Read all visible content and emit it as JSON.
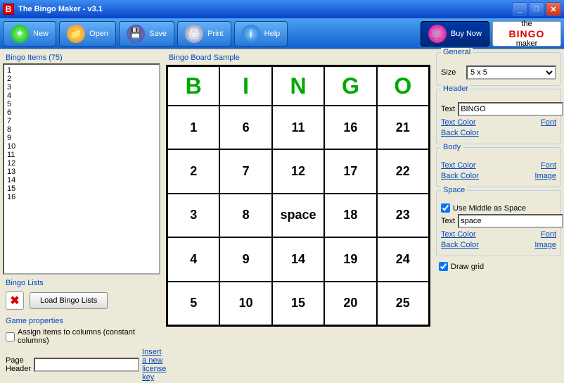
{
  "window": {
    "title": "The Bingo Maker - v3.1"
  },
  "toolbar": {
    "new": "New",
    "open": "Open",
    "save": "Save",
    "print": "Print",
    "help": "Help",
    "buy": "Buy Now"
  },
  "logo": {
    "small": "the",
    "big": "BINGO",
    "sub": "maker"
  },
  "left": {
    "items_label": "Bingo Items (75)",
    "items": [
      "1",
      "2",
      "3",
      "4",
      "5",
      "6",
      "7",
      "8",
      "9",
      "10",
      "11",
      "12",
      "13",
      "14",
      "15",
      "16"
    ],
    "lists_label": "Bingo Lists",
    "load_btn": "Load Bingo Lists",
    "gameprops_label": "Game properties",
    "assign_label": "Assign items to columns (constant columns)",
    "page_header_label": "Page Header",
    "page_header_value": "",
    "insert_license": "Insert a new license key"
  },
  "center": {
    "label": "Bingo Board Sample",
    "headers": [
      "B",
      "I",
      "N",
      "G",
      "O"
    ],
    "cells": [
      [
        "1",
        "6",
        "11",
        "16",
        "21"
      ],
      [
        "2",
        "7",
        "12",
        "17",
        "22"
      ],
      [
        "3",
        "8",
        "space",
        "18",
        "23"
      ],
      [
        "4",
        "9",
        "14",
        "19",
        "24"
      ],
      [
        "5",
        "10",
        "15",
        "20",
        "25"
      ]
    ]
  },
  "right": {
    "general": {
      "label": "General",
      "size_label": "Size",
      "size_value": "5 x 5"
    },
    "header": {
      "label": "Header",
      "text_label": "Text",
      "text_value": "BINGO",
      "text_color": "Text Color",
      "font": "Font",
      "back_color": "Back Color"
    },
    "body": {
      "label": "Body",
      "text_color": "Text Color",
      "font": "Font",
      "back_color": "Back Color",
      "image": "Image"
    },
    "space": {
      "label": "Space",
      "use_middle": "Use Middle as Space",
      "text_label": "Text",
      "text_value": "space",
      "text_color": "Text Color",
      "font": "Font",
      "back_color": "Back Color",
      "image": "Image"
    },
    "draw_grid": "Draw grid"
  }
}
